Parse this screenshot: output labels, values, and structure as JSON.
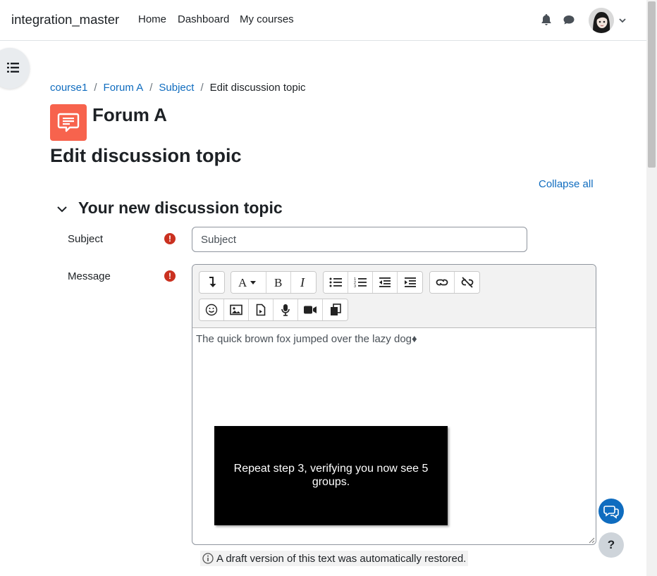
{
  "navbar": {
    "brand": "integration_master",
    "links": [
      "Home",
      "Dashboard",
      "My courses"
    ],
    "icons": [
      "bell-icon",
      "chat-icon",
      "user-avatar",
      "chevron-down-icon"
    ]
  },
  "breadcrumb": [
    "course1",
    "Forum A",
    "Subject",
    "Edit discussion topic"
  ],
  "activity": {
    "title": "Forum A",
    "icon": "forum-icon",
    "accent": "#f7634d"
  },
  "page_heading": "Edit discussion topic",
  "collapse_all": "Collapse all",
  "section": {
    "title": "Your new discussion topic"
  },
  "fields": {
    "subject": {
      "label": "Subject",
      "placeholder": "Subject",
      "required_icon": "!"
    },
    "message": {
      "label": "Message",
      "required_icon": "!",
      "content": "The quick brown fox jumped over the lazy dog♦"
    }
  },
  "editor_toolbar": {
    "row1": [
      "collapse-icon",
      "font-style-icon",
      "bold-icon",
      "italic-icon",
      "unordered-list-icon",
      "ordered-list-icon",
      "outdent-icon",
      "indent-icon",
      "link-icon",
      "unlink-icon"
    ],
    "row2": [
      "emoji-icon",
      "image-icon",
      "media-file-icon",
      "record-audio-icon",
      "record-video-icon",
      "manage-files-icon"
    ]
  },
  "draft_notice": "A draft version of this text was automatically restored.",
  "overlay_text": "Repeat step 3, verifying you now see 5 groups.",
  "help_button": "?",
  "colors": {
    "link": "#0f6cbf",
    "required": "#ca3120",
    "fab": "#0f6cbf"
  }
}
